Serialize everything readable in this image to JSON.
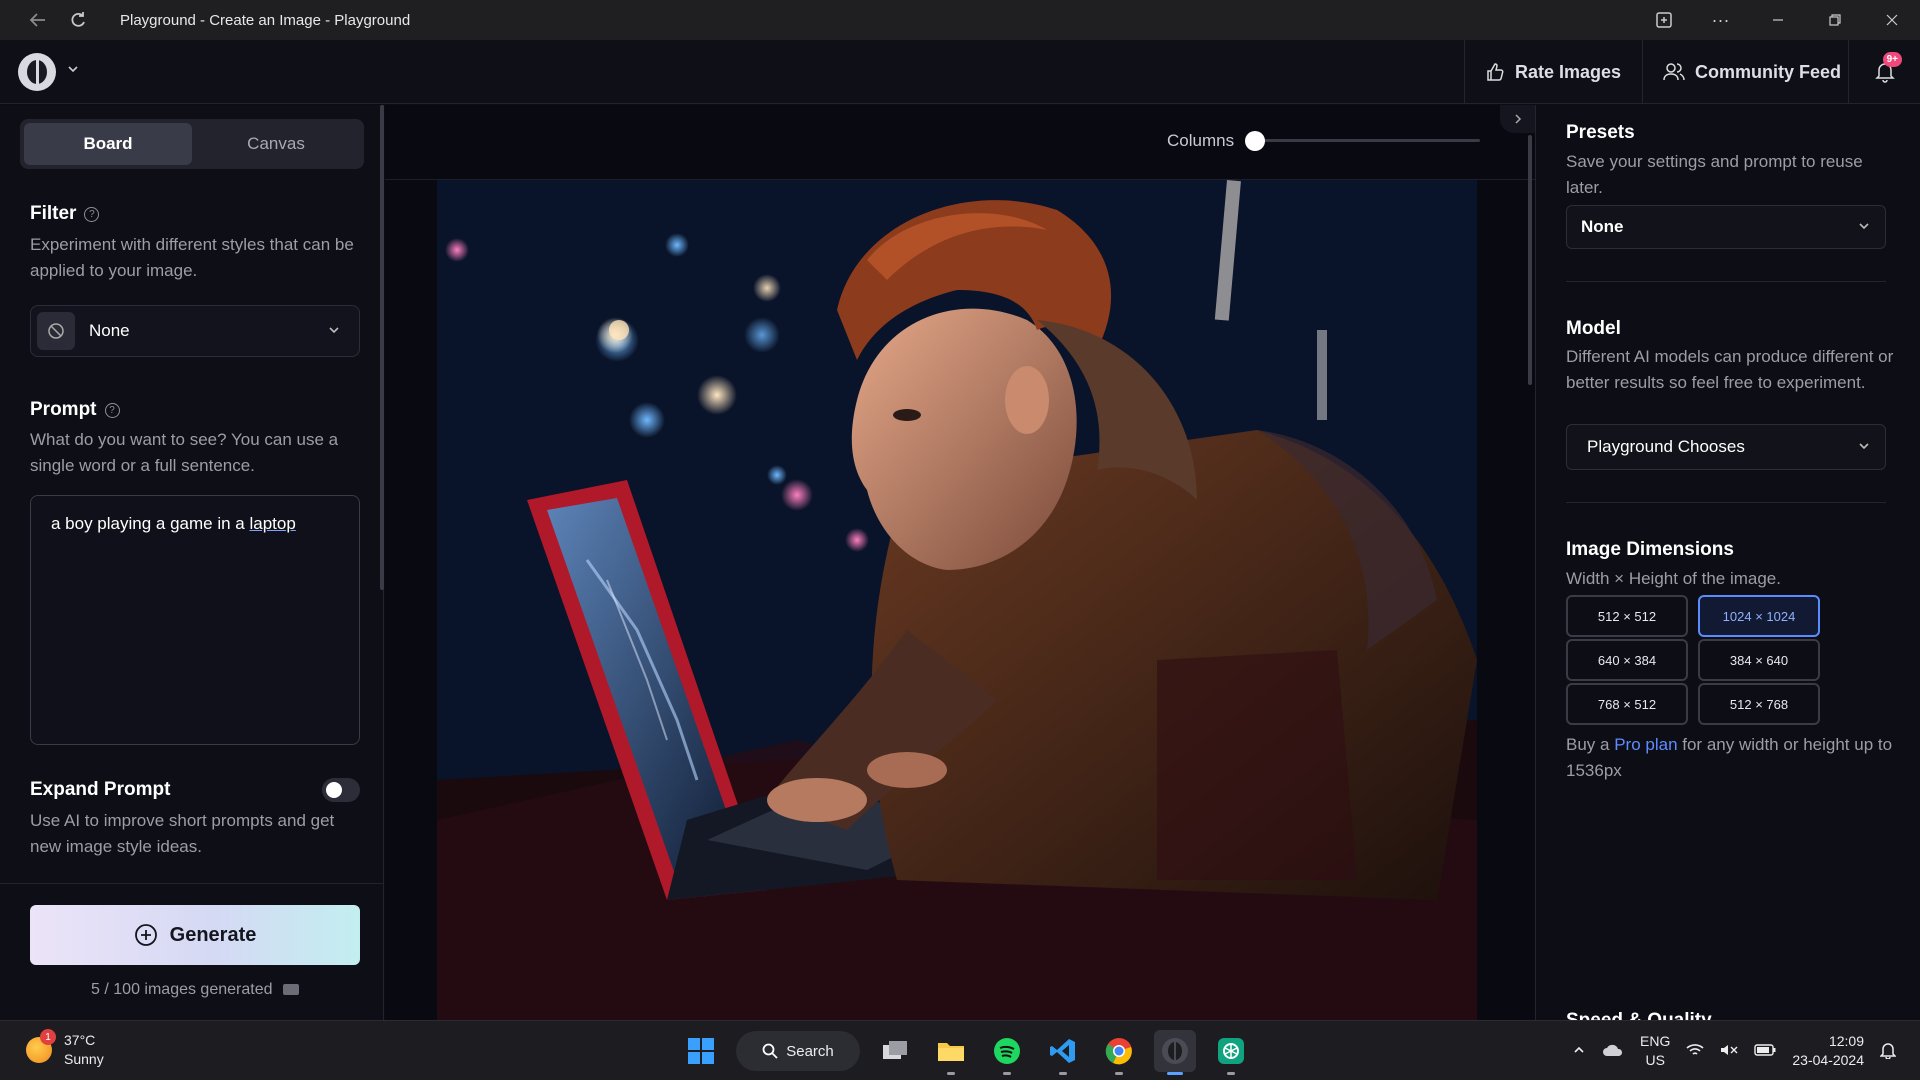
{
  "window": {
    "title": "Playground - Create an Image - Playground"
  },
  "header": {
    "rate_images": "Rate Images",
    "community_feed": "Community Feed",
    "notification_badge": "9+"
  },
  "left_panel": {
    "tabs": [
      {
        "label": "Board",
        "active": true
      },
      {
        "label": "Canvas",
        "active": false
      }
    ],
    "filter": {
      "title": "Filter",
      "help": "?",
      "description": "Experiment with different styles that can be applied to your image.",
      "value": "None"
    },
    "prompt": {
      "title": "Prompt",
      "help": "?",
      "description": "What do you want to see? You can use a single word or a full sentence.",
      "text_before": "a boy playing a game in a ",
      "text_underlined": "laptop"
    },
    "expand_prompt": {
      "title": "Expand Prompt",
      "description": "Use AI to improve short prompts and get new image style ideas.",
      "enabled": false
    },
    "generate_label": "Generate",
    "images_generated": "5 / 100 images generated"
  },
  "center": {
    "columns_label": "Columns",
    "columns_value": 0
  },
  "right_panel": {
    "presets": {
      "title": "Presets",
      "description": "Save your settings and prompt to reuse later.",
      "value": "None"
    },
    "model": {
      "title": "Model",
      "description": "Different AI models can produce different or better results so feel free to experiment.",
      "value": "Playground Chooses"
    },
    "dimensions": {
      "title": "Image Dimensions",
      "description": "Width × Height of the image.",
      "options": [
        {
          "label": "512 × 512",
          "selected": false
        },
        {
          "label": "1024 × 1024",
          "selected": true
        },
        {
          "label": "640 × 384",
          "selected": false
        },
        {
          "label": "384 × 640",
          "selected": false
        },
        {
          "label": "768 × 512",
          "selected": false
        },
        {
          "label": "512 × 768",
          "selected": false
        }
      ],
      "note_prefix": "Buy a ",
      "note_link": "Pro plan",
      "note_suffix": " for any width or height up to 1536px"
    },
    "next_section_cut": "Speed & Quality"
  },
  "taskbar": {
    "weather_badge": "1",
    "temperature": "37°C",
    "condition": "Sunny",
    "search_label": "Search",
    "language_line1": "ENG",
    "language_line2": "US",
    "time": "12:09",
    "date": "23-04-2024"
  },
  "colors": {
    "accent": "#5a8cff",
    "badge": "#f0487a",
    "panel_bg": "#0d0e16"
  }
}
